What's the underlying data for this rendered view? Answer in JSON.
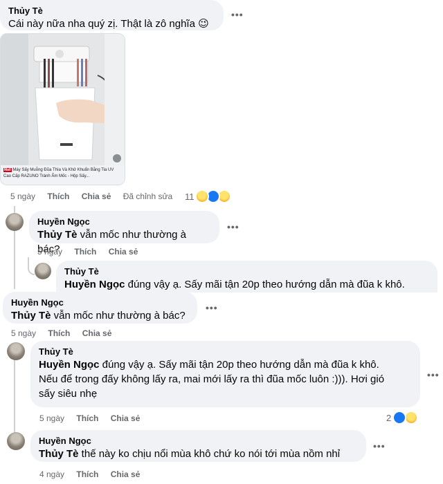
{
  "top_comment": {
    "author": "Thủy Tè",
    "text": "Cái này nữa nha quý zị. Thật là zô nghĩa 😉",
    "link_preview": {
      "badge": "Mall",
      "caption": "Máy Sấy Muỗng Đũa Thìa Và Khử Khuẩn Bằng Tia UV Cao Cấp RAZUNO Tránh Ẩm Mốc - Hộp Sấy..."
    },
    "actions": {
      "time": "5 ngày",
      "like": "Thích",
      "reply": "Chia sẻ",
      "edited": "Đã chỉnh sửa"
    },
    "reactions": {
      "count": "11",
      "types": [
        "haha-icon",
        "like-icon",
        "wow-icon"
      ]
    }
  },
  "reply1": {
    "author": "Huyền Ngọc",
    "mention": "Thủy Tè",
    "text": " vẫn mốc như thường à bác?",
    "actions": {
      "time": "5 ngày",
      "like": "Thích",
      "reply": "Chia sẻ"
    }
  },
  "reply2_partial": {
    "author": "Thủy Tè",
    "mention": "Huyền Ngọc",
    "text": " đúng vậy ạ. Sấy mãi tận 20p theo hướng dẫn mà đũa k khô."
  },
  "reply3": {
    "author": "Huyền Ngọc",
    "mention": "Thủy Tè",
    "text": " vẫn mốc như thường à bác?",
    "actions": {
      "time": "5 ngày",
      "like": "Thích",
      "reply": "Chia sẻ"
    }
  },
  "reply4": {
    "author": "Thủy Tè",
    "mention": "Huyền Ngọc",
    "line1": " đúng vậy ạ. Sấy mãi tận 20p theo hướng dẫn mà đũa k khô.",
    "line2": "Nếu để trong đấy không lấy ra, mai mới lấy ra thì đũa mốc luôn :))). Hơi gió",
    "line3": "sấy siêu nhẹ",
    "actions": {
      "time": "5 ngày",
      "like": "Thích",
      "reply": "Chia sẻ"
    },
    "reactions": {
      "count": "2",
      "types": [
        "like-icon",
        "haha-icon"
      ]
    }
  },
  "reply5": {
    "author": "Huyền Ngọc",
    "mention": "Thủy Tè",
    "text": " thế này ko chịu nổi mùa khô chứ ko nói tới mùa nồm nhỉ",
    "actions": {
      "time": "4 ngày",
      "like": "Thích",
      "reply": "Chia sẻ"
    }
  },
  "more_icon": "more-options-icon",
  "colors": {
    "bubble": "#f0f2f5",
    "meta": "#65676b",
    "like_blue": "#1877f2",
    "thread": "#ced0d4"
  }
}
